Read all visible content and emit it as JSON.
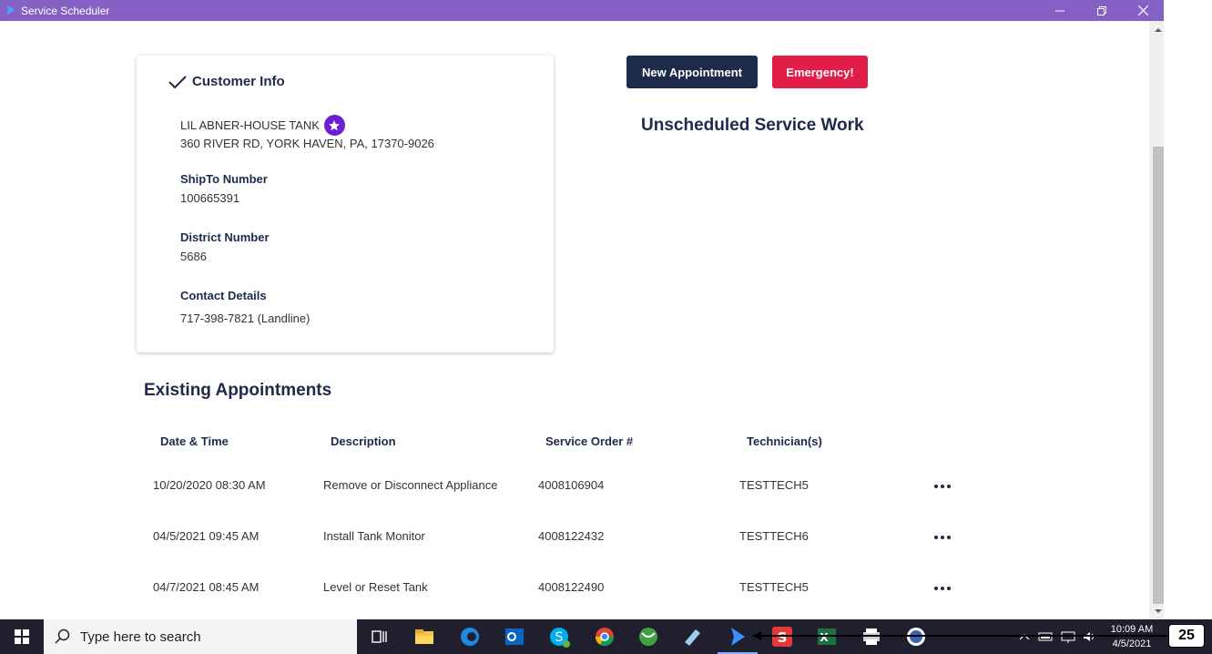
{
  "window": {
    "title": "Service Scheduler",
    "accent": "#8661c5"
  },
  "customer": {
    "header": "Customer Info",
    "name": "LIL ABNER-HOUSE TANK",
    "address": "360 RIVER RD, YORK HAVEN, PA, 17370-9026",
    "shipto_label": "ShipTo Number",
    "shipto_value": "100665391",
    "district_label": "District Number",
    "district_value": "5686",
    "contact_label": "Contact Details",
    "contact_value": "717-398-7821 (Landline)"
  },
  "actions": {
    "new_appointment": "New Appointment",
    "emergency": "Emergency!"
  },
  "unscheduled_title": "Unscheduled Service Work",
  "appointments": {
    "title": "Existing Appointments",
    "columns": [
      "Date & Time",
      "Description",
      "Service Order #",
      "Technician(s)"
    ],
    "rows": [
      {
        "datetime": "10/20/2020 08:30 AM",
        "description": "Remove or Disconnect Appliance",
        "order": "4008106904",
        "tech": "TESTTECH5"
      },
      {
        "datetime": "04/5/2021 09:45 AM",
        "description": "Install Tank Monitor",
        "order": "4008122432",
        "tech": "TESTTECH6"
      },
      {
        "datetime": "04/7/2021 08:45 AM",
        "description": "Level or Reset Tank",
        "order": "4008122490",
        "tech": "TESTTECH5"
      }
    ]
  },
  "taskbar": {
    "search_placeholder": "Type here to search",
    "time": "10:09 AM",
    "date": "4/5/2021"
  },
  "annotation": {
    "badge": "25"
  }
}
